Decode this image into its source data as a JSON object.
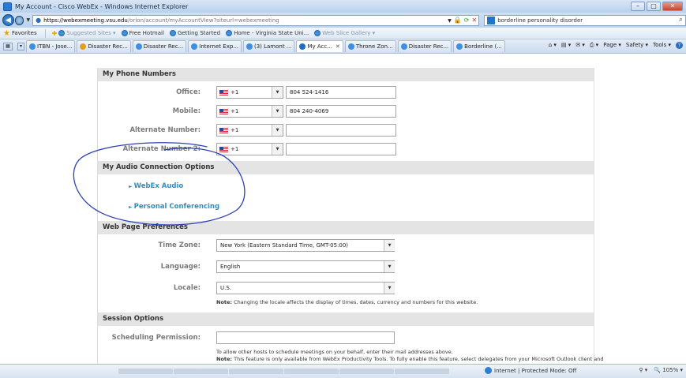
{
  "window": {
    "title": "My Account - Cisco WebEx - Windows Internet Explorer",
    "minimize": "–",
    "maximize": "□",
    "close": "✕"
  },
  "address_bar": {
    "url_host": "https://webexmeeting.vsu.edu",
    "url_path": "/orion/account/myAccountView?siteurl=webexmeeting",
    "search_text": "borderline personality disorder"
  },
  "favorites_bar": {
    "favorites_label": "Favorites",
    "items": [
      {
        "label": "Suggested Sites ▾",
        "muted": true
      },
      {
        "label": "Free Hotmail",
        "muted": false
      },
      {
        "label": "Getting Started",
        "muted": false
      },
      {
        "label": "Home - Virginia State Uni...",
        "muted": false
      },
      {
        "label": "Web Slice Gallery ▾",
        "muted": true
      }
    ]
  },
  "tabs": {
    "items": [
      {
        "label": "ITBN - Jose..."
      },
      {
        "label": "Disaster Rec..."
      },
      {
        "label": "Disaster Rec..."
      },
      {
        "label": "Internet Exp..."
      },
      {
        "label": "(3) Lamont ..."
      },
      {
        "label": "My Acc..."
      },
      {
        "label": "Throne Zon..."
      },
      {
        "label": "Disaster Rec..."
      },
      {
        "label": "Borderline (..."
      }
    ],
    "active_index": 5,
    "commands": {
      "page": "Page ▾",
      "safety": "Safety ▾",
      "tools": "Tools ▾"
    }
  },
  "phone_numbers": {
    "header": "My Phone Numbers",
    "rows": [
      {
        "label": "Office:",
        "country_code": "+1",
        "number": "804 524-1416"
      },
      {
        "label": "Mobile:",
        "country_code": "+1",
        "number": "804 240-4069"
      },
      {
        "label": "Alternate Number:",
        "country_code": "+1",
        "number": ""
      },
      {
        "label": "Alternate Number 2:",
        "country_code": "+1",
        "number": ""
      }
    ]
  },
  "audio_options": {
    "header": "My Audio Connection Options",
    "links": [
      "WebEx Audio",
      "Personal Conferencing"
    ]
  },
  "web_page_prefs": {
    "header": "Web Page Preferences",
    "time_zone_label": "Time Zone:",
    "time_zone_value": "New York (Eastern Standard Time, GMT-05:00)",
    "language_label": "Language:",
    "language_value": "English",
    "locale_label": "Locale:",
    "locale_value": "U.S.",
    "note_bold": "Note:",
    "note_text": " Changing the locale affects the display of times, dates, currency and numbers for this website."
  },
  "session_options": {
    "header": "Session Options",
    "scheduling_label": "Scheduling Permission:",
    "note1": "To allow other hosts to schedule meetings on your behalf, enter their mail addresses above.",
    "note2_bold": "Note:",
    "note2_text": " This feature is only available from WebEx Productivity Tools. To fully enable this feature, select delegates from your Microsoft Outlook client and"
  },
  "status_bar": {
    "zone": "Internet | Protected Mode: Off",
    "zoom": "105%"
  },
  "colors": {
    "link": "#2f8ec5",
    "section_header_bg": "#e4e4e4",
    "annotation": "#2a3fb8"
  }
}
